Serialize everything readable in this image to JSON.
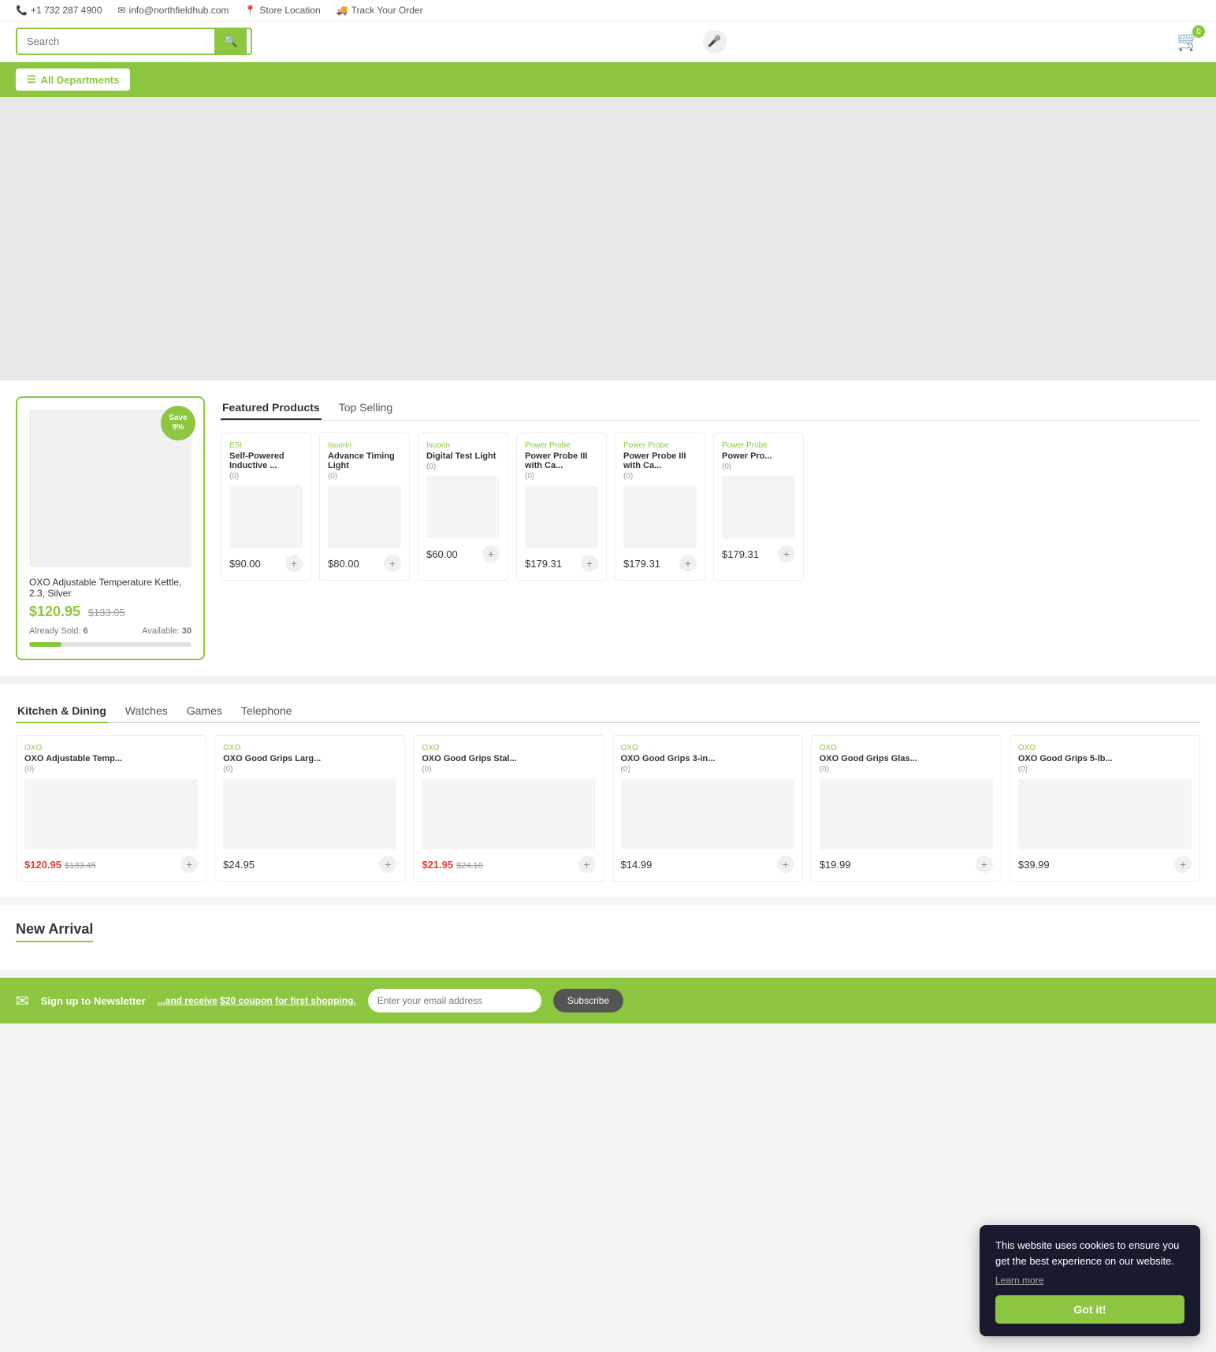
{
  "topbar": {
    "phone": "+1 732 287 4900",
    "email": "info@northfieldhub.com",
    "store_location": "Store Location",
    "track_order": "Track Your Order"
  },
  "header": {
    "search_placeholder": "Search",
    "cart_count": "0"
  },
  "nav": {
    "all_departments": "All Departments"
  },
  "featured": {
    "tab1": "Featured Products",
    "tab2": "Top Selling",
    "main_card": {
      "save_label": "Save",
      "save_percent": "9%",
      "title": "OXO Adjustable Temperature Kettle, 2.3, Silver",
      "price": "$120.95",
      "old_price": "$133.05",
      "sold_label": "Already Sold:",
      "sold_count": "6",
      "available_label": "Available:",
      "available_count": "30"
    },
    "products": [
      {
        "brand": "ESI",
        "name": "Self-Powered Inductive ...",
        "reviews": "(0)",
        "price": "$90.00"
      },
      {
        "brand": "Isuorin",
        "name": "Advance Timing Light",
        "reviews": "(0)",
        "price": "$80.00"
      },
      {
        "brand": "Isuorin",
        "name": "Digital Test Light",
        "reviews": "(0)",
        "price": "$60.00"
      },
      {
        "brand": "Power Probe",
        "name": "Power Probe III with Ca...",
        "reviews": "(0)",
        "price": "$179.31"
      },
      {
        "brand": "Power Probe",
        "name": "Power Probe III with Ca...",
        "reviews": "(0)",
        "price": "$179.31"
      },
      {
        "brand": "Power Probe",
        "name": "Power Pro...",
        "reviews": "(0)",
        "price": "$179.31"
      }
    ]
  },
  "categories": {
    "tabs": [
      "Kitchen & Dining",
      "Watches",
      "Games",
      "Telephone"
    ],
    "active_tab": "Kitchen & Dining",
    "products": [
      {
        "brand": "OXO",
        "name": "OXO Adjustable Temp...",
        "reviews": "(0)",
        "price": "$120.95",
        "old_price": "$133.45",
        "sale": true
      },
      {
        "brand": "OXO",
        "name": "OXO Good Grips Larg...",
        "reviews": "(0)",
        "price": "$24.95",
        "sale": false
      },
      {
        "brand": "OXO",
        "name": "OXO Good Grips Stal...",
        "reviews": "(0)",
        "price": "$21.95",
        "old_price": "$24.10",
        "sale": true
      },
      {
        "brand": "OXO",
        "name": "OXO Good Grips 3-in...",
        "reviews": "(0)",
        "price": "$14.99",
        "sale": false
      },
      {
        "brand": "OXO",
        "name": "OXO Good Grips Glas...",
        "reviews": "(0)",
        "price": "$19.99",
        "sale": false
      },
      {
        "brand": "OXO",
        "name": "OXO Good Grips 5-lb...",
        "reviews": "(0)",
        "price": "$39.99",
        "sale": false
      }
    ]
  },
  "new_arrival": {
    "title": "New Arrival"
  },
  "newsletter": {
    "icon": "✉",
    "label": "Sign up to Newsletter",
    "description_prefix": "...and receive",
    "coupon": "$20 coupon",
    "description_suffix": "for first shopping.",
    "input_placeholder": "Enter your email address",
    "button_label": "Subscribe"
  },
  "cookie": {
    "message": "This website uses cookies to ensure you get the best experience on our website.",
    "learn_more": "Learn more",
    "button_label": "Got it!"
  }
}
